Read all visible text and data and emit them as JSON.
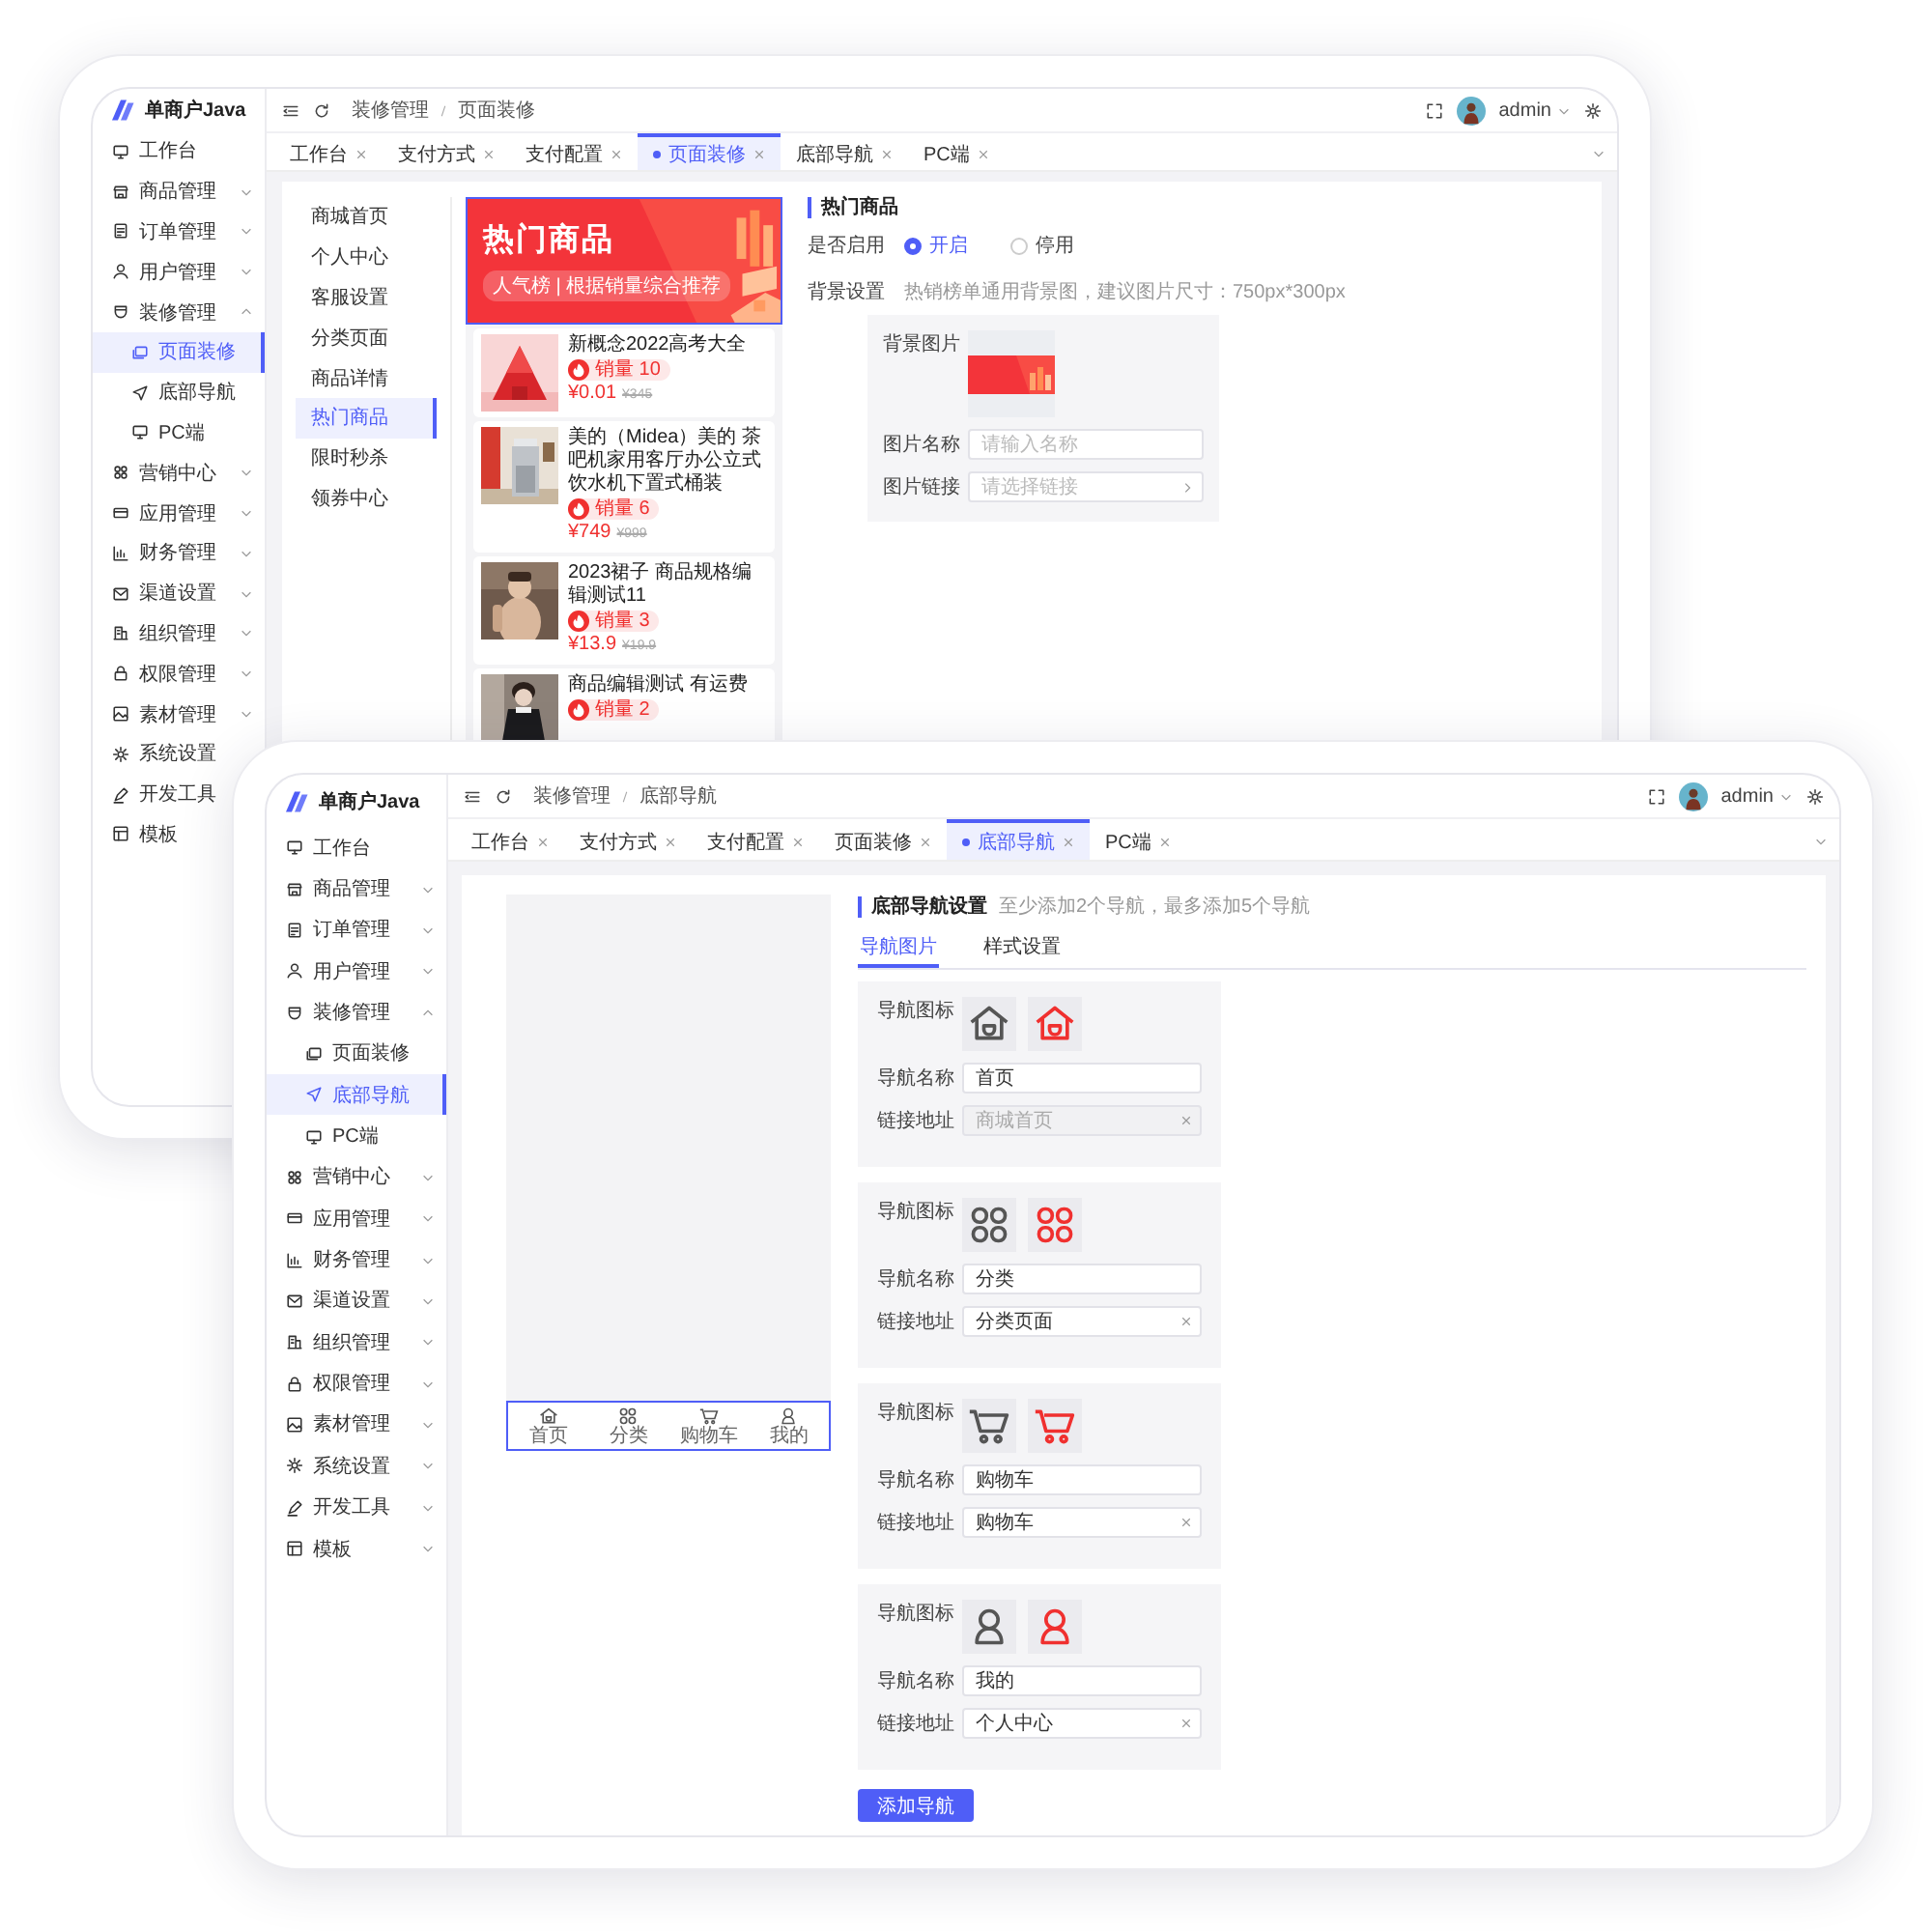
{
  "back_window": {
    "logo": "单商户Java",
    "breadcrumb": [
      "装修管理",
      "页面装修"
    ],
    "user": "admin",
    "sidebar": [
      {
        "label": "工作台",
        "selected": false
      },
      {
        "label": "商品管理",
        "selected": false,
        "expanded": false
      },
      {
        "label": "订单管理",
        "selected": false,
        "expanded": false
      },
      {
        "label": "用户管理",
        "selected": false,
        "expanded": false
      },
      {
        "label": "装修管理",
        "selected": false,
        "expanded": true,
        "children": [
          {
            "label": "页面装修",
            "selected": true
          },
          {
            "label": "底部导航",
            "selected": false
          },
          {
            "label": "PC端",
            "selected": false
          }
        ]
      },
      {
        "label": "营销中心",
        "selected": false,
        "expanded": false
      },
      {
        "label": "应用管理",
        "selected": false,
        "expanded": false
      },
      {
        "label": "财务管理",
        "selected": false,
        "expanded": false
      },
      {
        "label": "渠道设置",
        "selected": false,
        "expanded": false
      },
      {
        "label": "组织管理",
        "selected": false,
        "expanded": false
      },
      {
        "label": "权限管理",
        "selected": false,
        "expanded": false
      },
      {
        "label": "素材管理",
        "selected": false,
        "expanded": false
      },
      {
        "label": "系统设置",
        "selected": false
      },
      {
        "label": "开发工具",
        "selected": false
      },
      {
        "label": "模板",
        "selected": false
      }
    ],
    "tabs": [
      {
        "label": "工作台",
        "selected": false
      },
      {
        "label": "支付方式",
        "selected": false
      },
      {
        "label": "支付配置",
        "selected": false
      },
      {
        "label": "页面装修",
        "selected": true
      },
      {
        "label": "底部导航",
        "selected": false
      },
      {
        "label": "PC端",
        "selected": false
      }
    ],
    "pages": [
      {
        "label": "商城首页",
        "selected": false
      },
      {
        "label": "个人中心",
        "selected": false
      },
      {
        "label": "客服设置",
        "selected": false
      },
      {
        "label": "分类页面",
        "selected": false
      },
      {
        "label": "商品详情",
        "selected": false
      },
      {
        "label": "热门商品",
        "selected": true
      },
      {
        "label": "限时秒杀",
        "selected": false
      },
      {
        "label": "领券中心",
        "selected": false
      }
    ],
    "banner": {
      "title": "热门商品",
      "subtitle": "人气榜 | 根据销量综合推荐"
    },
    "products": [
      {
        "title": "新概念2022高考大全",
        "sales": "销量 10",
        "price": "¥0.01",
        "original_price": "¥345"
      },
      {
        "title": "美的（Midea）美的 茶吧机家用客厅办公立式饮水机下置式桶装",
        "sales": "销量 6",
        "price": "¥749",
        "original_price": "¥999"
      },
      {
        "title": "2023裙子 商品规格编辑测试11",
        "sales": "销量 3",
        "price": "¥13.9",
        "original_price": "¥19.9"
      },
      {
        "title": "商品编辑测试 有运费",
        "sales": "销量 2"
      }
    ],
    "settings": {
      "title": "热门商品",
      "enable_label": "是否启用",
      "enable_options": [
        {
          "label": "开启",
          "selected": true
        },
        {
          "label": "停用",
          "selected": false
        }
      ],
      "background_label": "背景设置",
      "background_hint": "热销榜单通用背景图，建议图片尺寸：750px*300px",
      "image_label": "背景图片",
      "name_label": "图片名称",
      "name_placeholder": "请输入名称",
      "link_label": "图片链接",
      "link_placeholder": "请选择链接"
    }
  },
  "front_window": {
    "logo": "单商户Java",
    "breadcrumb": [
      "装修管理",
      "底部导航"
    ],
    "user": "admin",
    "sidebar": [
      {
        "label": "工作台",
        "selected": false
      },
      {
        "label": "商品管理",
        "selected": false,
        "expanded": false
      },
      {
        "label": "订单管理",
        "selected": false,
        "expanded": false
      },
      {
        "label": "用户管理",
        "selected": false,
        "expanded": false
      },
      {
        "label": "装修管理",
        "selected": false,
        "expanded": true,
        "children": [
          {
            "label": "页面装修",
            "selected": false
          },
          {
            "label": "底部导航",
            "selected": true
          },
          {
            "label": "PC端",
            "selected": false
          }
        ]
      },
      {
        "label": "营销中心",
        "selected": false,
        "expanded": false
      },
      {
        "label": "应用管理",
        "selected": false,
        "expanded": false
      },
      {
        "label": "财务管理",
        "selected": false,
        "expanded": false
      },
      {
        "label": "渠道设置",
        "selected": false,
        "expanded": false
      },
      {
        "label": "组织管理",
        "selected": false,
        "expanded": false
      },
      {
        "label": "权限管理",
        "selected": false,
        "expanded": false
      },
      {
        "label": "素材管理",
        "selected": false,
        "expanded": false
      },
      {
        "label": "系统设置",
        "selected": false,
        "expanded": false
      },
      {
        "label": "开发工具",
        "selected": false,
        "expanded": false
      },
      {
        "label": "模板",
        "selected": false,
        "expanded": false
      }
    ],
    "tabs": [
      {
        "label": "工作台",
        "selected": false
      },
      {
        "label": "支付方式",
        "selected": false
      },
      {
        "label": "支付配置",
        "selected": false
      },
      {
        "label": "页面装修",
        "selected": false
      },
      {
        "label": "底部导航",
        "selected": true
      },
      {
        "label": "PC端",
        "selected": false
      }
    ],
    "bottom_bar": [
      {
        "label": "首页"
      },
      {
        "label": "分类"
      },
      {
        "label": "购物车"
      },
      {
        "label": "我的"
      }
    ],
    "nav_settings": {
      "title": "底部导航设置",
      "hint": "至少添加2个导航，最多添加5个导航",
      "tabs": [
        {
          "label": "导航图片",
          "selected": true
        },
        {
          "label": "样式设置",
          "selected": false
        }
      ],
      "items": [
        {
          "icon_label": "导航图标",
          "name_label": "导航名称",
          "name": "首页",
          "link_label": "链接地址",
          "link": "商城首页",
          "disabled": true
        },
        {
          "icon_label": "导航图标",
          "name_label": "导航名称",
          "name": "分类",
          "link_label": "链接地址",
          "link": "分类页面",
          "disabled": false
        },
        {
          "icon_label": "导航图标",
          "name_label": "导航名称",
          "name": "购物车",
          "link_label": "链接地址",
          "link": "购物车",
          "disabled": false
        },
        {
          "icon_label": "导航图标",
          "name_label": "导航名称",
          "name": "我的",
          "link_label": "链接地址",
          "link": "个人中心",
          "disabled": false
        }
      ],
      "add_button": "添加导航"
    }
  }
}
